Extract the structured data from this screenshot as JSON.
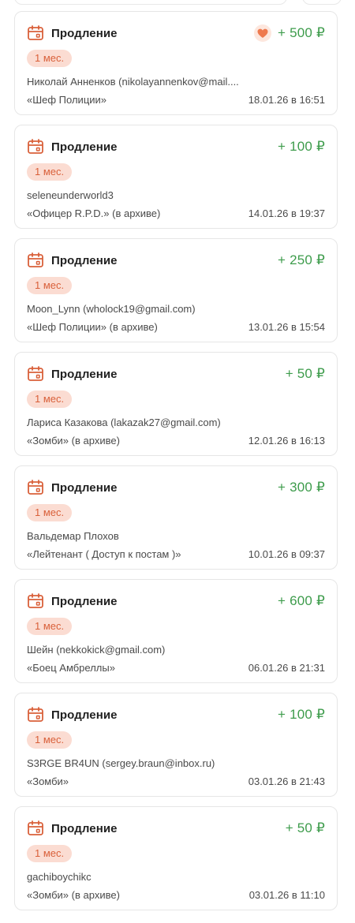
{
  "colors": {
    "accent": "#d9603a",
    "amount": "#3e9c4c",
    "badge_bg": "#fbdcd2",
    "border": "#e6e6e6"
  },
  "items": [
    {
      "icon": "calendar-icon",
      "title": "Продление",
      "amount": "+ 500 ₽",
      "has_heart": true,
      "period": "1 мес.",
      "user": "Николай Анненков (nikolayannenkov@mail....",
      "rank": "«Шеф Полиции»",
      "date": "18.01.26 в 16:51"
    },
    {
      "icon": "calendar-icon",
      "title": "Продление",
      "amount": "+ 100 ₽",
      "has_heart": false,
      "period": "1 мес.",
      "user": "seleneunderworld3",
      "rank": "«Офицер R.P.D.» (в архиве)",
      "date": "14.01.26 в 19:37"
    },
    {
      "icon": "calendar-icon",
      "title": "Продление",
      "amount": "+ 250 ₽",
      "has_heart": false,
      "period": "1 мес.",
      "user": "Moon_Lynn (wholock19@gmail.com)",
      "rank": "«Шеф Полиции» (в архиве)",
      "date": "13.01.26 в 15:54"
    },
    {
      "icon": "calendar-icon",
      "title": "Продление",
      "amount": "+ 50 ₽",
      "has_heart": false,
      "period": "1 мес.",
      "user": "Лариса Казакова (lakazak27@gmail.com)",
      "rank": "«Зомби» (в архиве)",
      "date": "12.01.26 в 16:13"
    },
    {
      "icon": "calendar-icon",
      "title": "Продление",
      "amount": "+ 300 ₽",
      "has_heart": false,
      "period": "1 мес.",
      "user": "Вальдемар Плохов",
      "rank": "«Лейтенант ( Доступ к постам )»",
      "date": "10.01.26 в 09:37"
    },
    {
      "icon": "calendar-icon",
      "title": "Продление",
      "amount": "+ 600 ₽",
      "has_heart": false,
      "period": "1 мес.",
      "user": "Шейн (nekkokick@gmail.com)",
      "rank": "«Боец Амбреллы»",
      "date": "06.01.26 в 21:31"
    },
    {
      "icon": "calendar-icon",
      "title": "Продление",
      "amount": "+ 100 ₽",
      "has_heart": false,
      "period": "1 мес.",
      "user": "S3RGE BR4UN (sergey.braun@inbox.ru)",
      "rank": "«Зомби»",
      "date": "03.01.26 в 21:43"
    },
    {
      "icon": "calendar-icon",
      "title": "Продление",
      "amount": "+ 50 ₽",
      "has_heart": false,
      "period": "1 мес.",
      "user": "gachiboychikc",
      "rank": "«Зомби» (в архиве)",
      "date": "03.01.26 в 11:10"
    }
  ]
}
